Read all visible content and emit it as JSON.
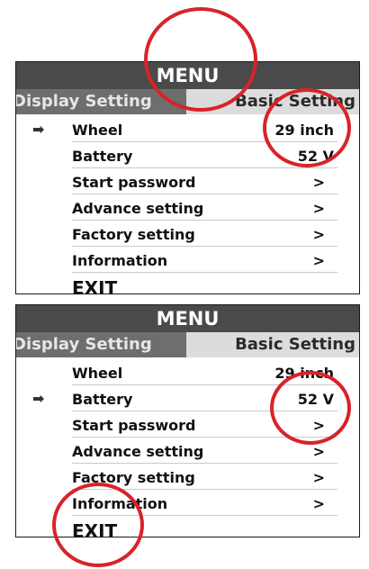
{
  "colors": {
    "header_bg": "#4a4a4a",
    "display_tab_bg": "#6e6e6e",
    "basic_tab_bg": "#dcdcdc",
    "highlight": "#d8232a"
  },
  "panels": [
    {
      "title": "MENU",
      "tabs": [
        "Display Setting",
        "Basic Setting"
      ],
      "selected_index": 0,
      "rows": [
        {
          "label": "Wheel",
          "value": "29 inch"
        },
        {
          "label": "Battery",
          "value": "52 V"
        },
        {
          "label": "Start password",
          "value": ">"
        },
        {
          "label": "Advance setting",
          "value": ">"
        },
        {
          "label": "Factory setting",
          "value": ">"
        },
        {
          "label": "Information",
          "value": ">"
        }
      ],
      "exit": "EXIT"
    },
    {
      "title": "MENU",
      "tabs": [
        "Display Setting",
        "Basic Setting"
      ],
      "selected_index": 1,
      "rows": [
        {
          "label": "Wheel",
          "value": "29 inch"
        },
        {
          "label": "Battery",
          "value": "52 V"
        },
        {
          "label": "Start password",
          "value": ">"
        },
        {
          "label": "Advance setting",
          "value": ">"
        },
        {
          "label": "Factory setting",
          "value": ">"
        },
        {
          "label": "Information",
          "value": ">"
        }
      ],
      "exit": "EXIT"
    }
  ],
  "arrow_icon": "right-arrow-icon",
  "annotation": "red-circle-highlight"
}
